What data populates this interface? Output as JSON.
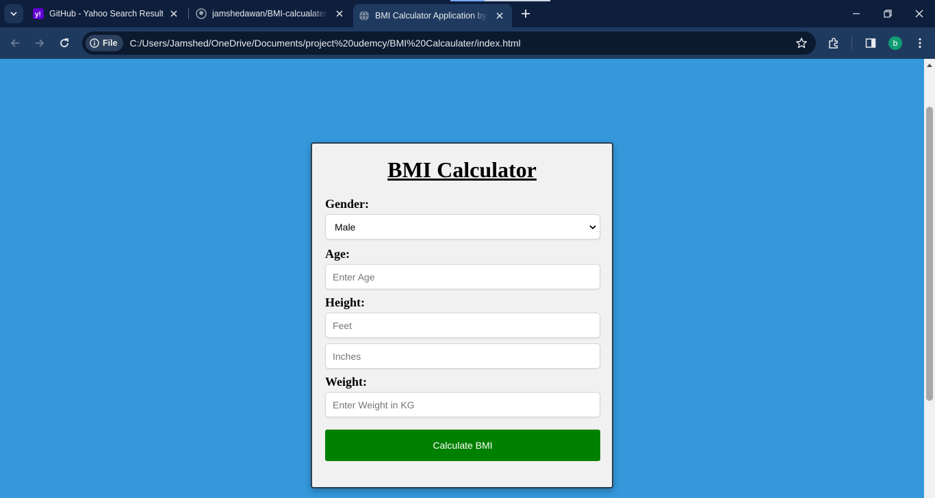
{
  "browser": {
    "tabs": [
      {
        "title": "GitHub - Yahoo Search Results",
        "favicon": "yahoo-icon",
        "active": false
      },
      {
        "title": "jamshedawan/BMI-calcualater: B",
        "favicon": "github-icon",
        "active": false
      },
      {
        "title": "BMI Calculator Application by ja",
        "favicon": "globe-icon",
        "active": true
      }
    ],
    "address": {
      "scheme_label": "File",
      "url": "C:/Users/Jamshed/OneDrive/Documents/project%20udemcy/BMI%20Calcaulater/index.html"
    },
    "profile_initial": "b",
    "colors": {
      "frame": "#0d1f3c",
      "toolbar": "#1f3a5f",
      "page_bg": "#3498db",
      "button": "#008000",
      "avatar": "#0f9d72"
    }
  },
  "page": {
    "title": "BMI Calculator",
    "gender": {
      "label": "Gender:",
      "selected": "Male"
    },
    "age": {
      "label": "Age:",
      "placeholder": "Enter Age"
    },
    "height": {
      "label": "Height:",
      "feet_placeholder": "Feet",
      "inches_placeholder": "Inches"
    },
    "weight": {
      "label": "Weight:",
      "placeholder": "Enter Weight in KG"
    },
    "calculate_label": "Calculate BMI"
  }
}
